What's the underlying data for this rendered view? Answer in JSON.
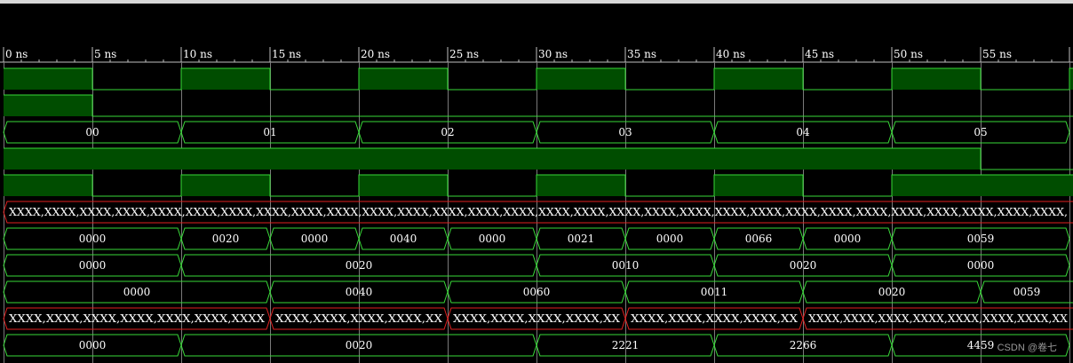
{
  "timeline": {
    "tick_labels": [
      "0 ns",
      "5 ns",
      "10 ns",
      "15 ns",
      "20 ns",
      "25 ns",
      "30 ns",
      "35 ns",
      "40 ns",
      "45 ns",
      "50 ns",
      "55 ns"
    ],
    "ns_per_major": 5,
    "minor_per_major": 5
  },
  "colors": {
    "background": "#000000",
    "signal_line": "#39d939",
    "high_fill": "#004d00",
    "invalid_line": "#e02020",
    "grid": "#bfbfbf",
    "text": "#ffffff"
  },
  "signals": [
    {
      "type": "bit",
      "start": 0,
      "levels": [
        1,
        0,
        1,
        0,
        1,
        0,
        1,
        0,
        1,
        0,
        1,
        0,
        1
      ]
    },
    {
      "type": "bit",
      "start": 0,
      "levels": [
        1,
        0,
        0,
        0,
        0,
        0,
        0,
        0,
        0,
        0,
        0,
        0,
        0
      ]
    },
    {
      "type": "bus",
      "segments": [
        {
          "start": 0,
          "end": 10,
          "label": "00"
        },
        {
          "start": 10,
          "end": 20,
          "label": "01"
        },
        {
          "start": 20,
          "end": 30,
          "label": "02"
        },
        {
          "start": 30,
          "end": 40,
          "label": "03"
        },
        {
          "start": 40,
          "end": 50,
          "label": "04"
        },
        {
          "start": 50,
          "end": 60,
          "label": "05"
        }
      ]
    },
    {
      "type": "bit",
      "start": 0,
      "levels": [
        1,
        1,
        1,
        1,
        1,
        1,
        1,
        1,
        1,
        1,
        1,
        0,
        0
      ]
    },
    {
      "type": "bit",
      "start": 0,
      "levels": [
        1,
        0,
        1,
        0,
        1,
        0,
        1,
        0,
        1,
        0,
        1,
        1,
        1
      ]
    },
    {
      "type": "bus",
      "invalid": true,
      "segments": [
        {
          "start": 0,
          "end": 61,
          "label": "XXXX,XXXX,XXXX,XXXX,XXXX,XXXX,XXXX,XXXX,XXXX,XXXX,XXXX,XXXX,XXXX,XXXX,XXXX,XXXX,XXXX,XXXX,XXXX,XXXX,XXXX,XXXX,XXXX,XXXX,XXXX,XXXX,XXXX,XXXX,XXXX,XXXX,"
        }
      ]
    },
    {
      "type": "bus",
      "segments": [
        {
          "start": 0,
          "end": 10,
          "label": "0000"
        },
        {
          "start": 10,
          "end": 15,
          "label": "0020"
        },
        {
          "start": 15,
          "end": 20,
          "label": "0000"
        },
        {
          "start": 20,
          "end": 25,
          "label": "0040"
        },
        {
          "start": 25,
          "end": 30,
          "label": "0000"
        },
        {
          "start": 30,
          "end": 35,
          "label": "0021"
        },
        {
          "start": 35,
          "end": 40,
          "label": "0000"
        },
        {
          "start": 40,
          "end": 45,
          "label": "0066"
        },
        {
          "start": 45,
          "end": 50,
          "label": "0000"
        },
        {
          "start": 50,
          "end": 60,
          "label": "0059"
        }
      ]
    },
    {
      "type": "bus",
      "segments": [
        {
          "start": 0,
          "end": 10,
          "label": "0000"
        },
        {
          "start": 10,
          "end": 30,
          "label": "0020"
        },
        {
          "start": 30,
          "end": 40,
          "label": "0010"
        },
        {
          "start": 40,
          "end": 50,
          "label": "0020"
        },
        {
          "start": 50,
          "end": 60,
          "label": "0000"
        }
      ]
    },
    {
      "type": "bus",
      "segments": [
        {
          "start": 0,
          "end": 15,
          "label": "0000"
        },
        {
          "start": 15,
          "end": 25,
          "label": "0040"
        },
        {
          "start": 25,
          "end": 35,
          "label": "0060"
        },
        {
          "start": 35,
          "end": 45,
          "label": "0011"
        },
        {
          "start": 45,
          "end": 55,
          "label": "0020"
        },
        {
          "start": 55,
          "end": 61,
          "label": "0059"
        }
      ]
    },
    {
      "type": "bus",
      "invalid": true,
      "segments": [
        {
          "start": 0,
          "end": 15,
          "label": "XXXX,XXXX,XXXX,XXXX,XXXX,XXXX,XXXX"
        },
        {
          "start": 15,
          "end": 25,
          "label": "XXXX,XXXX,XXXX,XXXX,XX"
        },
        {
          "start": 25,
          "end": 35,
          "label": "XXXX,XXXX,XXXX,XXXX,XX"
        },
        {
          "start": 35,
          "end": 45,
          "label": "XXXX,XXXX,XXXX,XXXX,XX"
        },
        {
          "start": 45,
          "end": 61,
          "label": "XXXX,XXXX,XXXX,XXXX,XXXX,XXXX,XXXX,XX"
        }
      ]
    },
    {
      "type": "bus",
      "segments": [
        {
          "start": 0,
          "end": 10,
          "label": "0000"
        },
        {
          "start": 10,
          "end": 30,
          "label": "0020"
        },
        {
          "start": 30,
          "end": 40,
          "label": "2221"
        },
        {
          "start": 40,
          "end": 50,
          "label": "2266"
        },
        {
          "start": 50,
          "end": 60,
          "label": "4459"
        }
      ]
    }
  ],
  "watermark": "CSDN @卷七"
}
